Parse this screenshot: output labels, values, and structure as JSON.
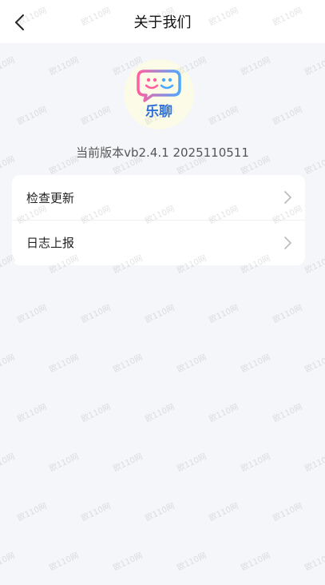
{
  "header": {
    "title": "关于我们"
  },
  "logo": {
    "text": "乐聊",
    "colors": {
      "bubble_gradient_start": "#ff5fa0",
      "bubble_gradient_end": "#4aa8ff",
      "text": "#2f6fd6"
    }
  },
  "app": {
    "version_text": "当前版本vb2.4.1 2025110511"
  },
  "menu": {
    "items": [
      {
        "label": "检查更新"
      },
      {
        "label": "日志上报"
      }
    ]
  },
  "watermark": {
    "text": "欧110网"
  },
  "icons": {
    "back": "chevron-left-icon",
    "row_arrow": "chevron-right-icon"
  }
}
